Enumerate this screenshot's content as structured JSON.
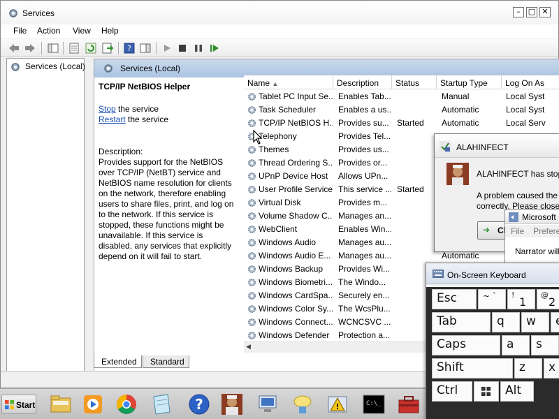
{
  "window": {
    "title": "Services",
    "app_icon": "gear-icon"
  },
  "menu": [
    "File",
    "Action",
    "View",
    "Help"
  ],
  "tree": {
    "item": "Services (Local)"
  },
  "pane": {
    "header": "Services (Local)",
    "selected_name": "TCP/IP NetBIOS Helper",
    "stop_link": "Stop",
    "stop_suffix": "the service",
    "restart_link": "Restart",
    "restart_suffix": "the service",
    "description_label": "Description:",
    "description": "Provides support for the NetBIOS over TCP/IP (NetBT) service and NetBIOS name resolution for clients on the network, therefore enabling users to share files, print, and log on to the network. If this service is stopped, these functions might be unavailable. If this service is disabled, any services that explicitly depend on it will fail to start."
  },
  "list": {
    "columns": [
      "Name",
      "Description",
      "Status",
      "Startup Type",
      "Log On As"
    ],
    "rows": [
      {
        "name": "Tablet PC Input Se...",
        "desc": "Enables Tab...",
        "status": "",
        "startup": "Manual",
        "logon": "Local Syst"
      },
      {
        "name": "Task Scheduler",
        "desc": "Enables a us...",
        "status": "",
        "startup": "Automatic",
        "logon": "Local Syst"
      },
      {
        "name": "TCP/IP NetBIOS H...",
        "desc": "Provides su...",
        "status": "Started",
        "startup": "Automatic",
        "logon": "Local Serv"
      },
      {
        "name": "Telephony",
        "desc": "Provides Tel...",
        "status": "",
        "startup": "",
        "logon": ""
      },
      {
        "name": "Themes",
        "desc": "Provides us...",
        "status": "",
        "startup": "",
        "logon": ""
      },
      {
        "name": "Thread Ordering S...",
        "desc": "Provides or...",
        "status": "",
        "startup": "",
        "logon": ""
      },
      {
        "name": "UPnP Device Host",
        "desc": "Allows UPn...",
        "status": "",
        "startup": "",
        "logon": ""
      },
      {
        "name": "User Profile Service",
        "desc": "This service ...",
        "status": "Started",
        "startup": "",
        "logon": ""
      },
      {
        "name": "Virtual Disk",
        "desc": "Provides m...",
        "status": "",
        "startup": "",
        "logon": ""
      },
      {
        "name": "Volume Shadow C...",
        "desc": "Manages an...",
        "status": "",
        "startup": "",
        "logon": ""
      },
      {
        "name": "WebClient",
        "desc": "Enables Win...",
        "status": "",
        "startup": "",
        "logon": ""
      },
      {
        "name": "Windows Audio",
        "desc": "Manages au...",
        "status": "",
        "startup": "",
        "logon": ""
      },
      {
        "name": "Windows Audio E...",
        "desc": "Manages au...",
        "status": "",
        "startup": "Automatic",
        "logon": ""
      },
      {
        "name": "Windows Backup",
        "desc": "Provides Wi...",
        "status": "",
        "startup": "",
        "logon": ""
      },
      {
        "name": "Windows Biometri...",
        "desc": "The Windo...",
        "status": "",
        "startup": "",
        "logon": ""
      },
      {
        "name": "Windows CardSpa...",
        "desc": "Securely en...",
        "status": "",
        "startup": "",
        "logon": ""
      },
      {
        "name": "Windows Color Sy...",
        "desc": "The WcsPlu...",
        "status": "",
        "startup": "",
        "logon": ""
      },
      {
        "name": "Windows Connect...",
        "desc": "WCNCSVC ...",
        "status": "",
        "startup": "",
        "logon": ""
      },
      {
        "name": "Windows Defender",
        "desc": "Protection a...",
        "status": "",
        "startup": "",
        "logon": ""
      }
    ]
  },
  "tabs": [
    "Extended",
    "Standard"
  ],
  "taskbar": {
    "start_label": "Start",
    "apps": [
      "folder-icon",
      "media-player-icon",
      "chrome-icon",
      "notepad-icon",
      "help-icon",
      "alahinfect-icon",
      "network-icon",
      "chat-icon",
      "warning-icon",
      "cmd-icon",
      "toolbox-icon"
    ]
  },
  "error_dialog": {
    "title": "ALAHINFECT",
    "message": "ALAHINFECT has stopp",
    "detail": "A problem caused the correctly. Please close t",
    "button": "Cl"
  },
  "narrator": {
    "title": "Microsoft",
    "menu": [
      "File",
      "Prefere"
    ],
    "text": "Narrator will"
  },
  "osk": {
    "title": "On-Screen Keyboard",
    "keys": {
      "esc": "Esc",
      "tilde": "~ `",
      "one_top": "!",
      "one": "1",
      "two_top": "@",
      "two": "2",
      "tab": "Tab",
      "q": "q",
      "w": "w",
      "e": "e",
      "caps": "Caps",
      "a": "a",
      "s": "s",
      "shift": "Shift",
      "z": "z",
      "x": "x",
      "ctrl": "Ctrl",
      "alt": "Alt"
    }
  },
  "colors": {
    "header_blue": "#abc4e2",
    "link": "#1a4fb2",
    "start_green": "#2f8f2f"
  }
}
